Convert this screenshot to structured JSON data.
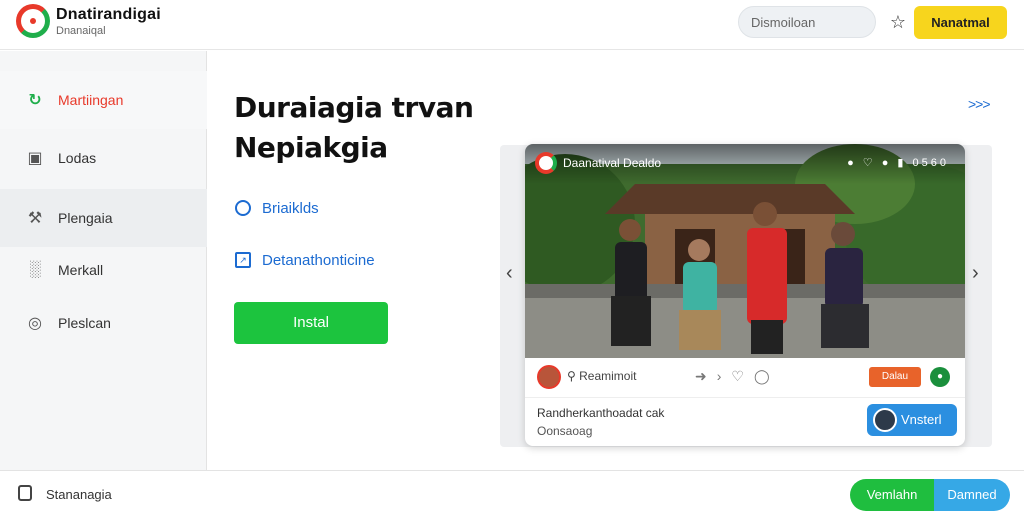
{
  "header": {
    "brand": "Dnatirandigai",
    "brand_sub": "Dnanaiqal",
    "search_placeholder": "Dismoiloan",
    "cta_label": "Nanatmal"
  },
  "sidebar": {
    "items": [
      {
        "label": "Martiingan",
        "icon": "logo-icon"
      },
      {
        "label": "Lodas",
        "icon": "briefcase-icon"
      },
      {
        "label": "Plengaia",
        "icon": "tool-icon"
      },
      {
        "label": "Merkall",
        "icon": "chart-icon"
      },
      {
        "label": "Pleslcan",
        "icon": "target-icon"
      }
    ]
  },
  "main": {
    "title_line1": "Duraiagia trvan",
    "title_line2": "Nepiakgia",
    "features": [
      "Briaiklds",
      "Detanathonticine"
    ],
    "install_label": "Instal",
    "more_label": ">>>"
  },
  "preview": {
    "app_name": "Daanatival",
    "app_sub": "Dealdo",
    "top_icons": "● ♡ ● ▮ 0560",
    "search_text": "Reamimoit",
    "chip_label": "Dalau",
    "dot_label": "●",
    "info_line1": "Randherkanthoadat cak",
    "info_line2": "Oonsaoag",
    "button_label": "Vnsterl"
  },
  "footer": {
    "label": "Stananagia",
    "btn_a": "Vemlahn",
    "btn_b": "Damned"
  },
  "colors": {
    "brand_red": "#e8392a",
    "brand_green": "#1fae4b",
    "accent_yellow": "#f7d51d",
    "link_blue": "#1c6bd1",
    "install_green": "#1cc43e"
  }
}
